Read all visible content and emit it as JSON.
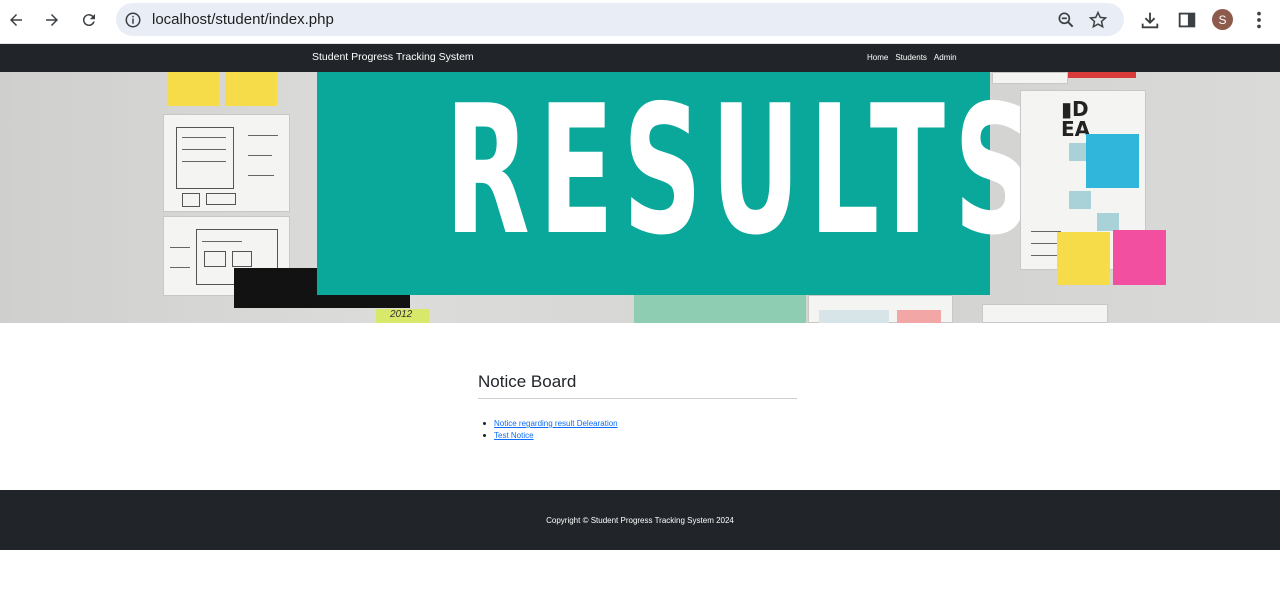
{
  "browser": {
    "url": "localhost/student/index.php",
    "avatar_letter": "S",
    "icons": [
      "back-icon",
      "forward-icon",
      "reload-icon",
      "info-icon",
      "zoom-icon",
      "star-icon",
      "download-icon",
      "side-panel-icon",
      "menu-dots-icon"
    ]
  },
  "navbar": {
    "brand": "Student Progress Tracking System",
    "links": [
      "Home",
      "Students",
      "Admin"
    ]
  },
  "hero": {
    "banner_text": "RESULTS",
    "tag_text": "2012",
    "accent": "#0aa89a"
  },
  "notice_board": {
    "title": "Notice Board",
    "items": [
      "Notice regarding result Delearation",
      "Test Notice"
    ]
  },
  "footer": {
    "copyright": "Copyright © Student Progress Tracking System 2024"
  },
  "colors": {
    "navbar_bg": "#212529",
    "link": "#0d6efd",
    "omnibox_bg": "#e9eef6"
  }
}
